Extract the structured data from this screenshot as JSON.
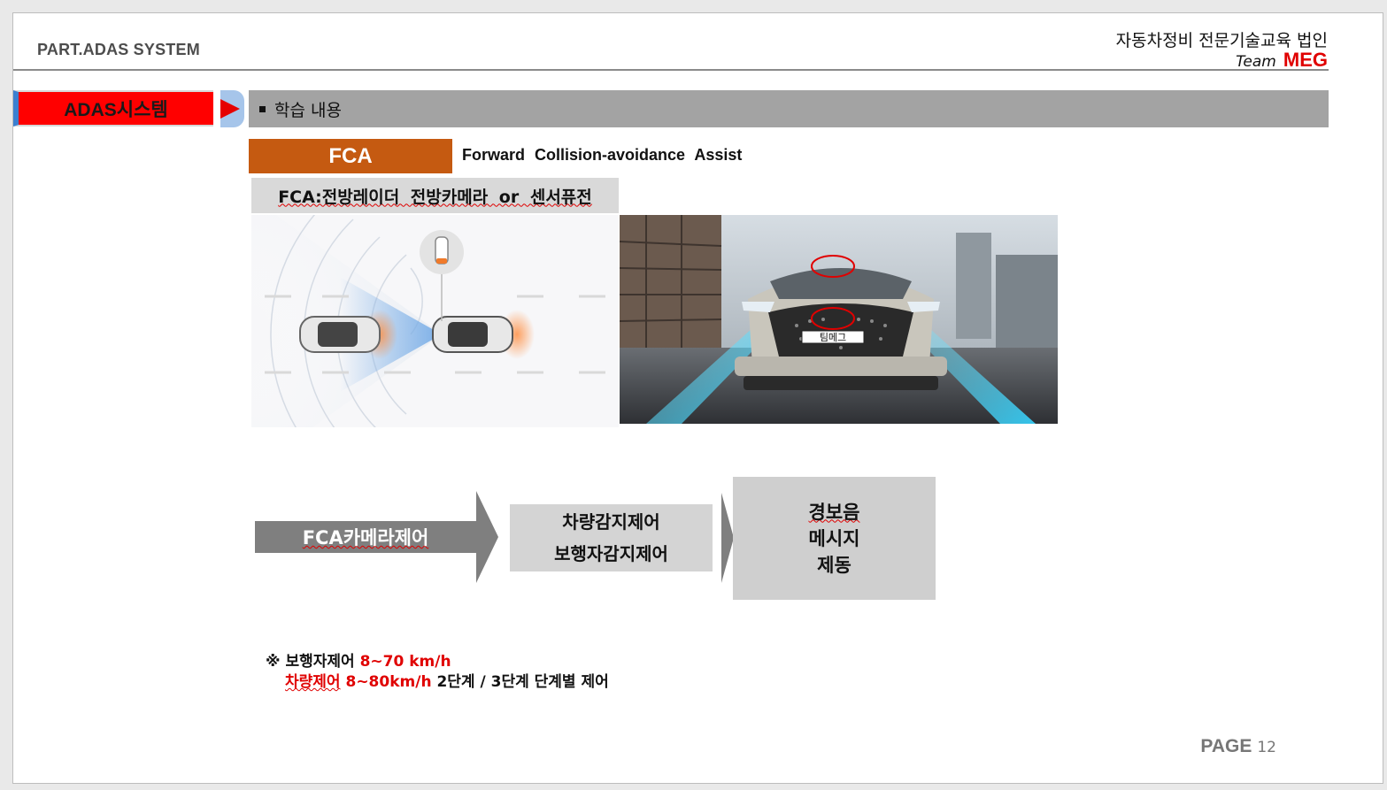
{
  "header": {
    "part_title": "PART.ADAS SYSTEM",
    "company": "자동차정비 전문기술교육 법인",
    "team_word": "Team",
    "team_name": "MEG"
  },
  "section": {
    "badge": "ADAS시스템",
    "topic": "학습 내용"
  },
  "fca": {
    "tag": "FCA",
    "full_name": "Forward Collision-avoidance Assist",
    "sensor_line": "FCA:전방레이더 전방카메라 or 센서퓨전"
  },
  "images": {
    "car_plate": "팀메그"
  },
  "flow": {
    "step1": "FCA카메라제어",
    "step2_line1": "차량감지제어",
    "step2_line2": "보행자감지제어",
    "step3_line1": "경보음",
    "step3_line2": "메시지",
    "step3_line3": "제동"
  },
  "note": {
    "mark": "※",
    "line1_label": "보행자제어",
    "line1_value": "8~70 km/h",
    "line2_label": "차량제어",
    "line2_value": "8~80km/h",
    "line2_rest": "2단계 / 3단계 단계별 제어"
  },
  "footer": {
    "page_label": "PAGE",
    "page_number": "12"
  },
  "colors": {
    "badge_red": "#ff0000",
    "fca_orange": "#c55a11",
    "topic_gray": "#a3a3a3",
    "accent_red": "#e00000",
    "arrow_gray": "#7f7f7f"
  }
}
